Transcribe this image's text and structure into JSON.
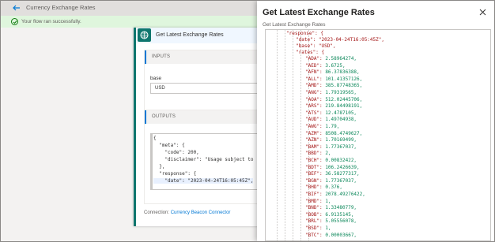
{
  "header": {
    "title": "Currency Exchange Rates"
  },
  "banner": {
    "message": "Your flow ran successfully."
  },
  "card": {
    "title": "Get Latest Exchange Rates",
    "inputs": {
      "section_label": "INPUTS",
      "field_label": "base",
      "field_value": "USD"
    },
    "outputs": {
      "section_label": "OUTPUTS",
      "field_label": "body",
      "code_lines": [
        "{",
        "  \"meta\": {",
        "    \"code\": 200,",
        "    \"disclaimer\": \"Usage subject to",
        "  },",
        "  \"response\": {",
        "    \"date\": \"2023-04-24T16:05:45Z\","
      ]
    },
    "connection_label": "Connection:",
    "connection_name": "Currency Beacon Connector"
  },
  "panel": {
    "title": "Get Latest Exchange Rates",
    "subtitle": "Get Latest Exchange Rates",
    "header_lines": [
      "\"response\": {",
      "\"date\": \"2023-04-24T16:05:45Z\",",
      "\"base\": \"USD\",",
      "\"rates\": {"
    ],
    "rates": [
      {
        "code": "ADA",
        "value": "2.58964274,"
      },
      {
        "code": "AED",
        "value": "3.6725,"
      },
      {
        "code": "AFN",
        "value": "86.37836388,"
      },
      {
        "code": "ALL",
        "value": "101.41357126,"
      },
      {
        "code": "AMD",
        "value": "385.87748365,"
      },
      {
        "code": "ANG",
        "value": "1.79319565,"
      },
      {
        "code": "AOA",
        "value": "512.02445706,"
      },
      {
        "code": "ARS",
        "value": "219.84498191,"
      },
      {
        "code": "ATS",
        "value": "12.4787105,"
      },
      {
        "code": "AUD",
        "value": "1.49704938,"
      },
      {
        "code": "AWG",
        "value": "1.79,"
      },
      {
        "code": "AZM",
        "value": "8508.4749627,"
      },
      {
        "code": "AZN",
        "value": "1.70169499,"
      },
      {
        "code": "BAM",
        "value": "1.77367037,"
      },
      {
        "code": "BBD",
        "value": "2,"
      },
      {
        "code": "BCH",
        "value": "0.00832422,"
      },
      {
        "code": "BDT",
        "value": "106.2426639,"
      },
      {
        "code": "BEF",
        "value": "36.58277317,"
      },
      {
        "code": "BGN",
        "value": "1.77367037,"
      },
      {
        "code": "BHD",
        "value": "0.376,"
      },
      {
        "code": "BIF",
        "value": "2078.49276422,"
      },
      {
        "code": "BMD",
        "value": "1,"
      },
      {
        "code": "BND",
        "value": "1.33480779,"
      },
      {
        "code": "BOB",
        "value": "6.9135145,"
      },
      {
        "code": "BRL",
        "value": "5.05556078,"
      },
      {
        "code": "BSD",
        "value": "1,"
      },
      {
        "code": "BTC",
        "value": "0.00003667,"
      }
    ]
  }
}
